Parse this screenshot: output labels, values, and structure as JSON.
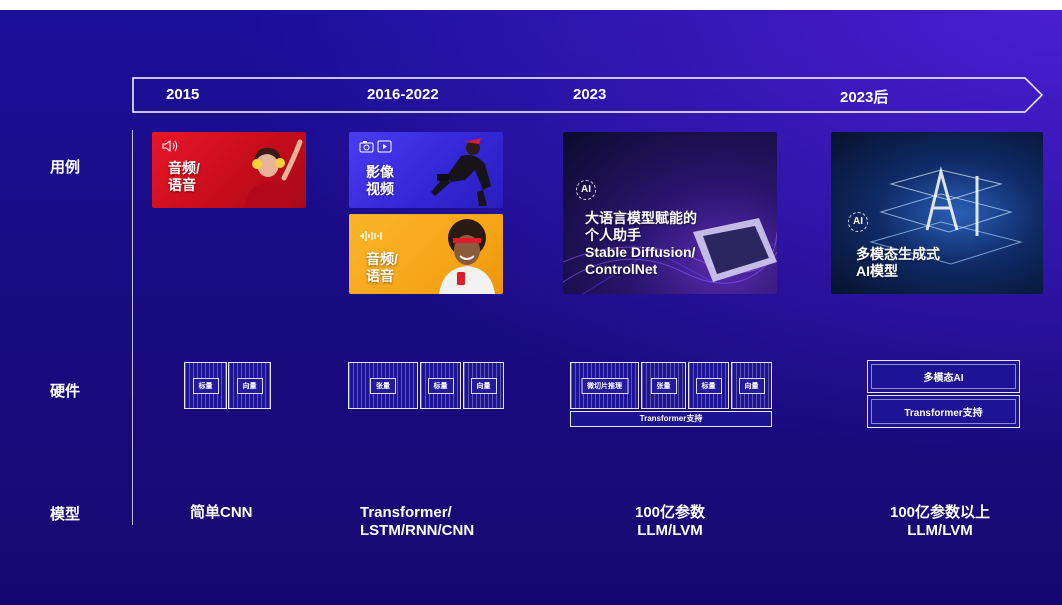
{
  "timeline": {
    "years": [
      "2015",
      "2016-2022",
      "2023",
      "2023后"
    ]
  },
  "rows": {
    "use_cases": "用例",
    "hardware": "硬件",
    "models": "模型"
  },
  "use_cases": {
    "c2015": {
      "lines": [
        "音频/",
        "语音"
      ],
      "icon": "speaker-icon"
    },
    "c2016_video": {
      "lines": [
        "影像",
        "视频"
      ],
      "icons": [
        "camera-icon",
        "play-icon"
      ]
    },
    "c2016_audio": {
      "lines": [
        "音频/",
        "语音"
      ],
      "icon": "waveform-icon"
    },
    "c2023": {
      "badge": "AI",
      "lines": [
        "大语言模型赋能的",
        "个人助手",
        "Stable Diffusion/",
        "ControlNet"
      ]
    },
    "c2023plus": {
      "badge": "AI",
      "lines": [
        "多模态生成式",
        "AI模型"
      ]
    }
  },
  "hardware": {
    "h2015": [
      "标量",
      "向量"
    ],
    "h2016": [
      "张量",
      "标量",
      "向量"
    ],
    "h2023": [
      "微切片推理",
      "张量",
      "标量",
      "向量"
    ],
    "h2023_bar": "Transformer支持",
    "h2023plus": [
      "多模态AI",
      "Transformer支持"
    ]
  },
  "models": {
    "m2015": "简单CNN",
    "m2016": [
      "Transformer/",
      "LSTM/RNN/CNN"
    ],
    "m2023": [
      "100亿参数",
      "LLM/LVM"
    ],
    "m2023plus": [
      "100亿参数以上",
      "LLM/LVM"
    ]
  },
  "colors": {
    "background": "#1a0c86",
    "card_red": "#d0101e",
    "card_blue": "#3b2fe0",
    "card_yellow": "#f7a81b",
    "outline": "#e9e6ff"
  }
}
